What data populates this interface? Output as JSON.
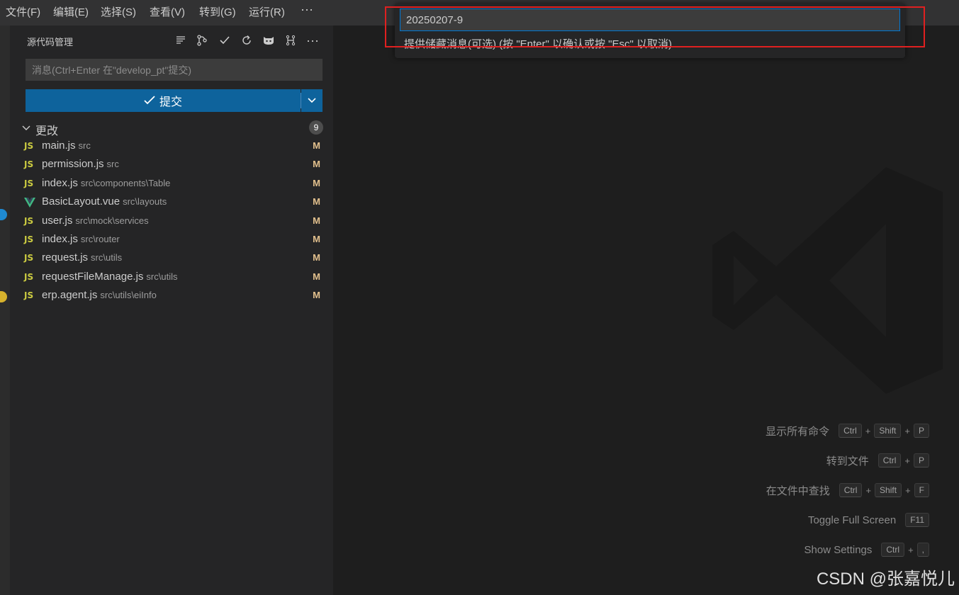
{
  "menubar": {
    "items": [
      "文件(F)",
      "编辑(E)",
      "选择(S)",
      "查看(V)",
      "转到(G)",
      "运行(R)"
    ],
    "more": "···"
  },
  "sidebar": {
    "title": "源代码管理",
    "toolbar_icons": [
      "view-list-icon",
      "branch-graph-icon",
      "check-icon",
      "refresh-icon",
      "github-icon",
      "source-tree-icon",
      "more-icon"
    ],
    "message_placeholder": "消息(Ctrl+Enter 在\"develop_pt\"提交)",
    "commit_label": "提交",
    "changes_label": "更改",
    "changes_count": "9",
    "files": [
      {
        "icon": "JS",
        "name": "main.js",
        "path": "src",
        "status": "M"
      },
      {
        "icon": "JS",
        "name": "permission.js",
        "path": "src",
        "status": "M"
      },
      {
        "icon": "JS",
        "name": "index.js",
        "path": "src\\components\\Table",
        "status": "M"
      },
      {
        "icon": "vue",
        "name": "BasicLayout.vue",
        "path": "src\\layouts",
        "status": "M"
      },
      {
        "icon": "JS",
        "name": "user.js",
        "path": "src\\mock\\services",
        "status": "M"
      },
      {
        "icon": "JS",
        "name": "index.js",
        "path": "src\\router",
        "status": "M"
      },
      {
        "icon": "JS",
        "name": "request.js",
        "path": "src\\utils",
        "status": "M"
      },
      {
        "icon": "JS",
        "name": "requestFileManage.js",
        "path": "src\\utils",
        "status": "M"
      },
      {
        "icon": "JS",
        "name": "erp.agent.js",
        "path": "src\\utils\\eiInfo",
        "status": "M"
      }
    ]
  },
  "quick_input": {
    "value": "20250207-9",
    "hint": "提供储藏消息(可选) (按 \"Enter\" 以确认或按 \"Esc\" 以取消)"
  },
  "shortcuts": [
    {
      "label": "显示所有命令",
      "keys": [
        "Ctrl",
        "Shift",
        "P"
      ]
    },
    {
      "label": "转到文件",
      "keys": [
        "Ctrl",
        "P"
      ]
    },
    {
      "label": "在文件中查找",
      "keys": [
        "Ctrl",
        "Shift",
        "F"
      ]
    },
    {
      "label": "Toggle Full Screen",
      "keys": [
        "F11"
      ]
    },
    {
      "label": "Show Settings",
      "keys": [
        "Ctrl",
        ","
      ]
    }
  ],
  "watermark_text": "CSDN @张嘉悦儿",
  "colors": {
    "accent": "#0e639c",
    "highlight_box": "#e02020",
    "modified": "#e2c08d",
    "js_icon": "#cbcb41",
    "vue_icon": "#41b883"
  }
}
